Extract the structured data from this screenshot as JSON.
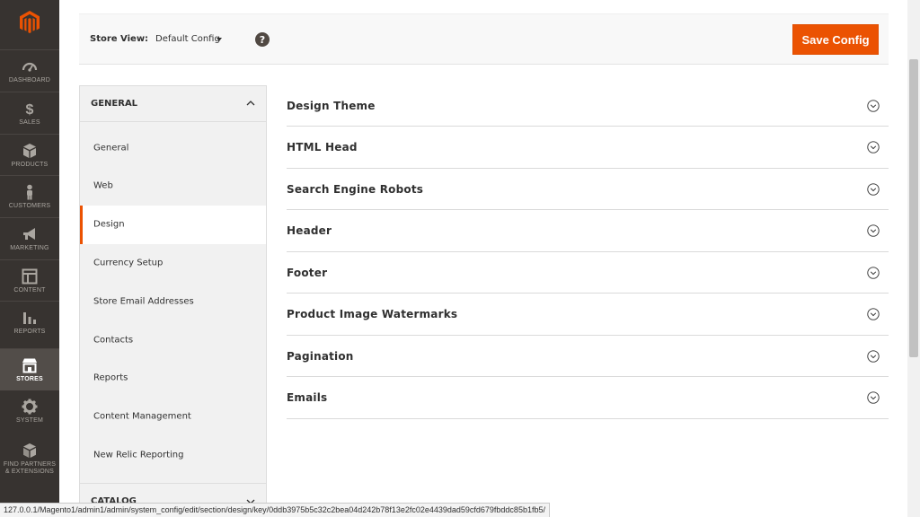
{
  "nav": {
    "items": [
      {
        "label": "DASHBOARD",
        "icon": "speedometer-icon"
      },
      {
        "label": "SALES",
        "icon": "dollar-icon"
      },
      {
        "label": "PRODUCTS",
        "icon": "box-icon"
      },
      {
        "label": "CUSTOMERS",
        "icon": "person-icon"
      },
      {
        "label": "MARKETING",
        "icon": "megaphone-icon"
      },
      {
        "label": "CONTENT",
        "icon": "layout-icon"
      },
      {
        "label": "REPORTS",
        "icon": "bar-chart-icon"
      },
      {
        "label": "STORES",
        "icon": "storefront-icon"
      },
      {
        "label": "SYSTEM",
        "icon": "gear-icon"
      },
      {
        "label": "FIND PARTNERS & EXTENSIONS",
        "icon": "cube-icon"
      }
    ],
    "active": "STORES",
    "colors": {
      "bg": "#373330",
      "active_bg": "#524d49",
      "logo": "#eb5202"
    }
  },
  "header": {
    "store_view_label": "Store View:",
    "store_view_value": "Default Config",
    "help": "?",
    "save_label": "Save Config",
    "save_color": "#eb5202"
  },
  "tabs": {
    "group_title": "GENERAL",
    "items": [
      "General",
      "Web",
      "Design",
      "Currency Setup",
      "Store Email Addresses",
      "Contacts",
      "Reports",
      "Content Management",
      "New Relic Reporting"
    ],
    "active": "Design",
    "next_group_title": "CATALOG"
  },
  "sections": [
    "Design Theme",
    "HTML Head",
    "Search Engine Robots",
    "Header",
    "Footer",
    "Product Image Watermarks",
    "Pagination",
    "Emails"
  ],
  "status_url": "127.0.0.1/Magento1/admin1/admin/system_config/edit/section/design/key/0ddb3975b5c32c2bea04d242b78f13e2fc02e4439dad59cfd679fbddc85b1fb5/"
}
